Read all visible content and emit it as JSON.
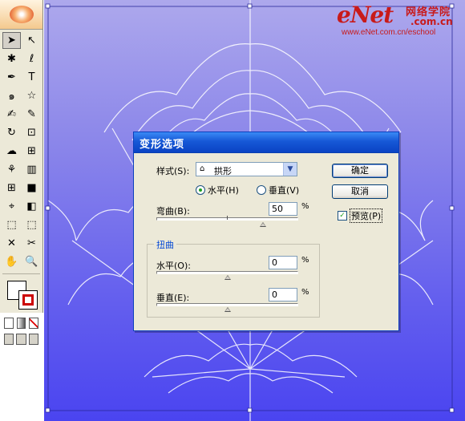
{
  "watermark": {
    "brand": "eNet",
    "chinese": "网络学院",
    "com": ".com.cn",
    "url": "www.eNet.com.cn/eschool"
  },
  "toolbox": {
    "tools": [
      "selection-arrow-icon",
      "direct-select-icon",
      "magic-wand-icon",
      "lasso-icon",
      "pen-icon",
      "type-icon",
      "spiral-icon",
      "star-icon",
      "paintbrush-icon",
      "pencil-icon",
      "rotate-icon",
      "scale-icon",
      "warp-icon",
      "free-transform-icon",
      "symbol-sprayer-icon",
      "graph-icon",
      "mesh-icon",
      "gradient-icon",
      "eyedropper-icon",
      "blend-icon",
      "live-paint-icon",
      "live-paint-select-icon",
      "slice-icon",
      "scissors-icon",
      "hand-icon",
      "zoom-icon"
    ],
    "tool_glyphs": [
      "➤",
      "↖",
      "✱",
      "ℓ",
      "✒",
      "T",
      "๑",
      "☆",
      "✍",
      "✎",
      "↻",
      "⊡",
      "☁",
      "⊞",
      "⚘",
      "▥",
      "⊞",
      "■",
      "⌖",
      "◧",
      "⬚",
      "⬚",
      "✕",
      "✂",
      "✋",
      "🔍"
    ]
  },
  "dialog": {
    "title": "变形选项",
    "style_label": "样式(S):",
    "style_value": "拱形",
    "horizontal_label": "水平(H)",
    "vertical_label": "垂直(V)",
    "orientation_selected": "horizontal",
    "bend_label": "弯曲(B):",
    "bend_value": "50",
    "bend_percent": 50,
    "percent_sign": "%",
    "distortion_group": "扭曲",
    "h_distort_label": "水平(O):",
    "h_distort_value": "0",
    "h_distort_percent": 0,
    "v_distort_label": "垂直(E):",
    "v_distort_value": "0",
    "v_distort_percent": 0,
    "ok_label": "确定",
    "cancel_label": "取消",
    "preview_label": "预览(P)",
    "preview_checked": true
  }
}
